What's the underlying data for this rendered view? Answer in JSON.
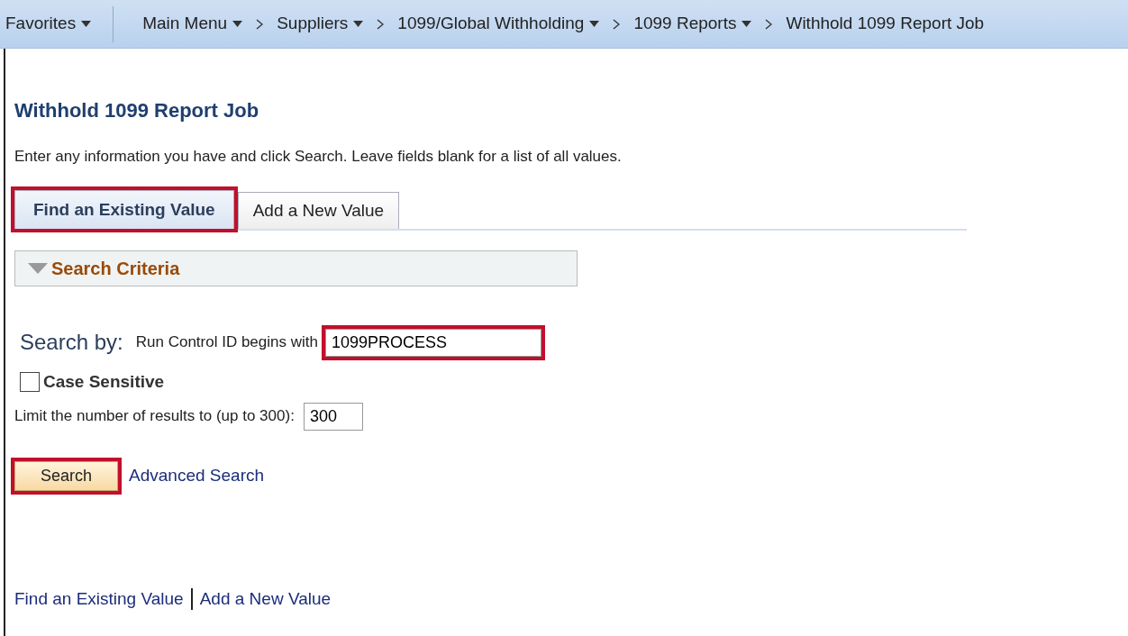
{
  "breadcrumb": [
    {
      "label": "Favorites",
      "dropdown": true
    },
    {
      "label": "Main Menu",
      "dropdown": true
    },
    {
      "label": "Suppliers",
      "dropdown": true
    },
    {
      "label": "1099/Global Withholding",
      "dropdown": true
    },
    {
      "label": "1099 Reports",
      "dropdown": true
    },
    {
      "label": "Withhold 1099 Report Job",
      "dropdown": false
    }
  ],
  "page_title": "Withhold 1099 Report Job",
  "instructions": "Enter any information you have and click Search. Leave fields blank for a list of all values.",
  "tabs": [
    {
      "label": "Find an Existing Value",
      "selected": true,
      "highlighted": true
    },
    {
      "label": "Add a New Value",
      "selected": false,
      "highlighted": false
    }
  ],
  "search_criteria": {
    "title": "Search Criteria",
    "expanded": true
  },
  "search_by": {
    "label": "Search by:",
    "field_label": "Run Control ID begins with",
    "value": "1099PROCESS",
    "highlighted": true
  },
  "case_sensitive": {
    "label": "Case Sensitive",
    "checked": false
  },
  "limit": {
    "label": "Limit the number of results to (up to 300):",
    "value": "300"
  },
  "search_button": {
    "label": "Search",
    "highlighted": true
  },
  "advanced_search": "Advanced Search",
  "footer_links": [
    "Find an Existing Value",
    "Add a New Value"
  ]
}
